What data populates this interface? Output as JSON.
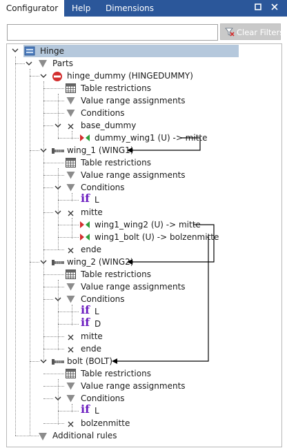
{
  "tabs": [
    "Configurator",
    "Help",
    "Dimensions"
  ],
  "window_controls": {
    "restore_icon": "square-icon",
    "close_icon": "close-icon"
  },
  "search": {
    "value": "",
    "placeholder": ""
  },
  "clear_filters_label": "Clear Filters",
  "tree": {
    "root": "Hinge",
    "parts": "Parts",
    "hinge_dummy": "hinge_dummy (HINGEDUMMY)",
    "table_restrictions": "Table restrictions",
    "value_range_assignments": "Value range assignments",
    "conditions": "Conditions",
    "base_dummy": "base_dummy",
    "dummy_wing1": "dummy_wing1 (U) -> mitte",
    "wing_1": "wing_1 (WING1)",
    "if_L": "L",
    "if_D": "D",
    "if_keyword": "if",
    "mitte": "mitte",
    "wing1_wing2": "wing1_wing2 (U) -> mitte",
    "wing1_bolt": "wing1_bolt (U) -> bolzenmitte",
    "ende": "ende",
    "wing_2": "wing_2 (WING2)",
    "bolt": "bolt (BOLT)",
    "bolzenmitte": "bolzenmitte",
    "additional_rules": "Additional rules"
  },
  "colors": {
    "tab_bar": "#2b579a",
    "selection": "#b5c8dc",
    "if_keyword": "#6a1bbf",
    "arrow": "#000000"
  }
}
